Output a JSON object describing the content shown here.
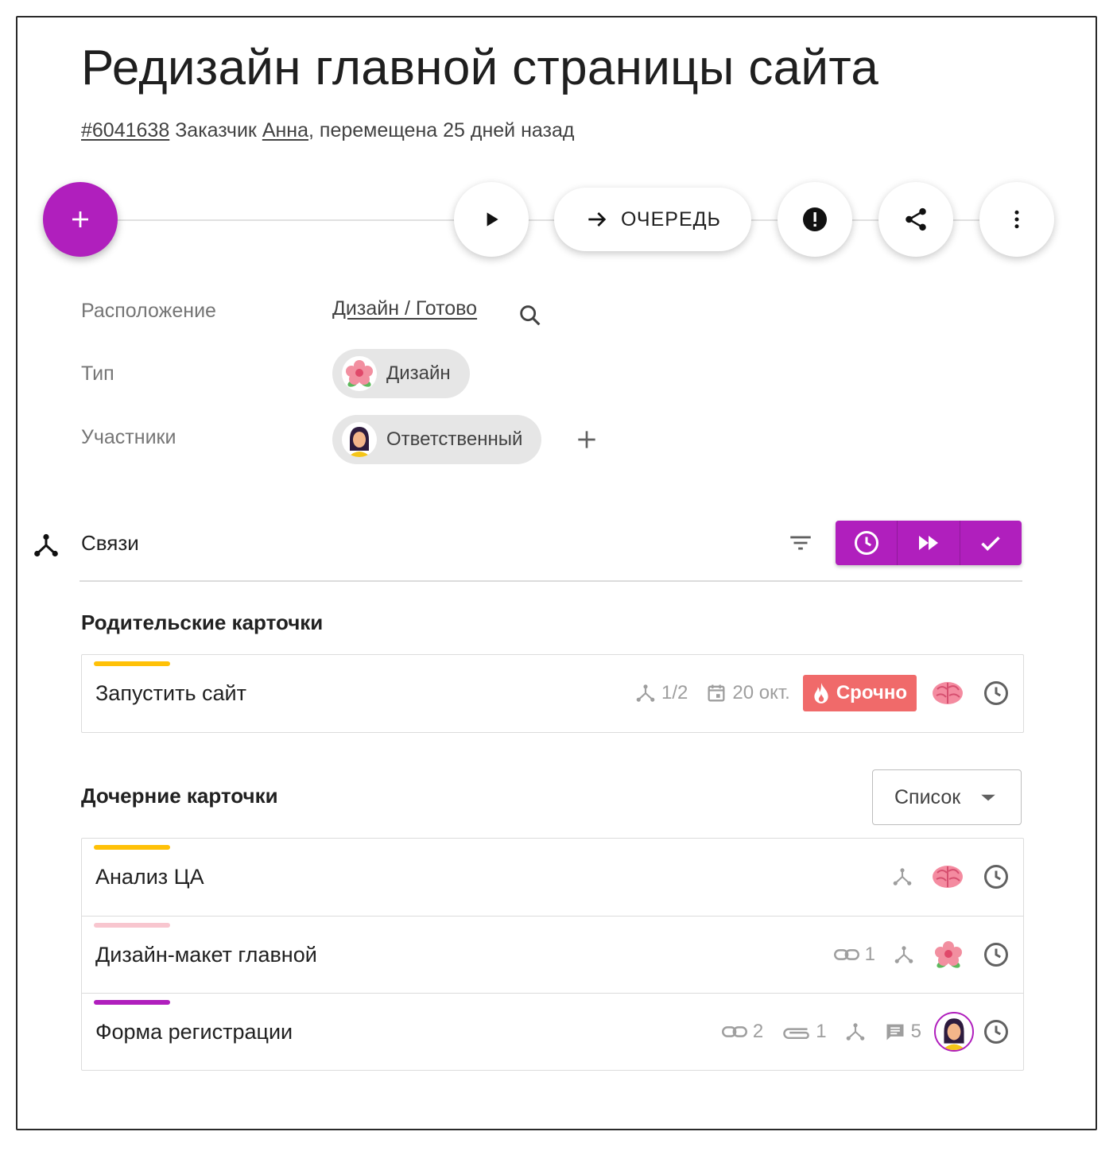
{
  "card": {
    "title": "Редизайн главной страницы сайта",
    "id": "#6041638",
    "customer_prefix": "Заказчик",
    "customer_name": "Анна",
    "moved_text": ", перемещена 25 дней назад"
  },
  "toolbar": {
    "add_icon": "plus-icon",
    "play_icon": "play-icon",
    "queue_label": "ОЧЕРЕДЬ",
    "queue_icon": "arrow-right-icon",
    "alert_icon": "exclamation-circle-icon",
    "share_icon": "share-icon",
    "more_icon": "more-vert-icon",
    "accent": "#b01fbd"
  },
  "fields": {
    "location_label": "Расположение",
    "location_value": "Дизайн / Готово",
    "type_label": "Тип",
    "type_value": "Дизайн",
    "members_label": "Участники",
    "members_value": "Ответственный"
  },
  "links": {
    "title": "Связи",
    "parents_title": "Родительские карточки",
    "children_title": "Дочерние карточки",
    "view_select": "Список",
    "parents": [
      {
        "name": "Запустить сайт",
        "bar_color": "#ffc107",
        "children_count": "1/2",
        "due": "20 окт.",
        "urgent_label": "Срочно"
      }
    ],
    "children": [
      {
        "name": "Анализ ЦА",
        "bar_color": "#ffc107"
      },
      {
        "name": "Дизайн-макет главной",
        "bar_color": "#f8c6cf",
        "links": "1"
      },
      {
        "name": "Форма регистрации",
        "bar_color": "#b01fbd",
        "links": "2",
        "attachments": "1",
        "comments": "5"
      }
    ]
  }
}
